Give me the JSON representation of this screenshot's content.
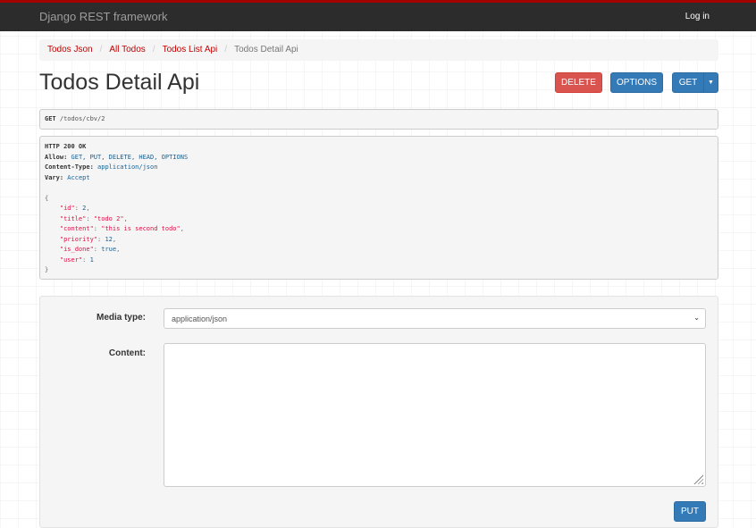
{
  "navbar": {
    "brand": "Django REST framework",
    "login": "Log in"
  },
  "breadcrumb": [
    "Todos Json",
    "All Todos",
    "Todos List Api",
    "Todos Detail Api"
  ],
  "page_title": "Todos Detail Api",
  "buttons": {
    "delete": "DELETE",
    "options": "OPTIONS",
    "get": "GET",
    "put": "PUT"
  },
  "request": {
    "method": "GET",
    "path": "/todos/cbv/2"
  },
  "response": {
    "status": "HTTP 200 OK",
    "headers": [
      {
        "name": "Allow:",
        "value": "GET, PUT, DELETE, HEAD, OPTIONS"
      },
      {
        "name": "Content-Type:",
        "value": "application/json"
      },
      {
        "name": "Vary:",
        "value": "Accept"
      }
    ],
    "body": {
      "open": "{",
      "close": "}",
      "fields": [
        {
          "key": "\"id\"",
          "value": "2",
          "kind": "num",
          "comma": ","
        },
        {
          "key": "\"title\"",
          "value": "\"todo 2\"",
          "kind": "str",
          "comma": ","
        },
        {
          "key": "\"content\"",
          "value": "\"this is second todo\"",
          "kind": "str",
          "comma": ","
        },
        {
          "key": "\"priority\"",
          "value": "12",
          "kind": "num",
          "comma": ","
        },
        {
          "key": "\"is_done\"",
          "value": "true",
          "kind": "num",
          "comma": ","
        },
        {
          "key": "\"user\"",
          "value": "1",
          "kind": "num",
          "comma": ""
        }
      ]
    }
  },
  "form": {
    "media_type_label": "Media type:",
    "media_type_value": "application/json",
    "content_label": "Content:"
  },
  "colors": {
    "navbar": "#2c2c2c",
    "accent_red": "#a30000",
    "link": "#c20000",
    "primary": "#337ab7",
    "danger": "#d9534f"
  },
  "icons": {
    "select_caret": "chevron-down-icon",
    "get_dropdown": "caret-down-icon",
    "resize": "resize-grip-icon"
  }
}
